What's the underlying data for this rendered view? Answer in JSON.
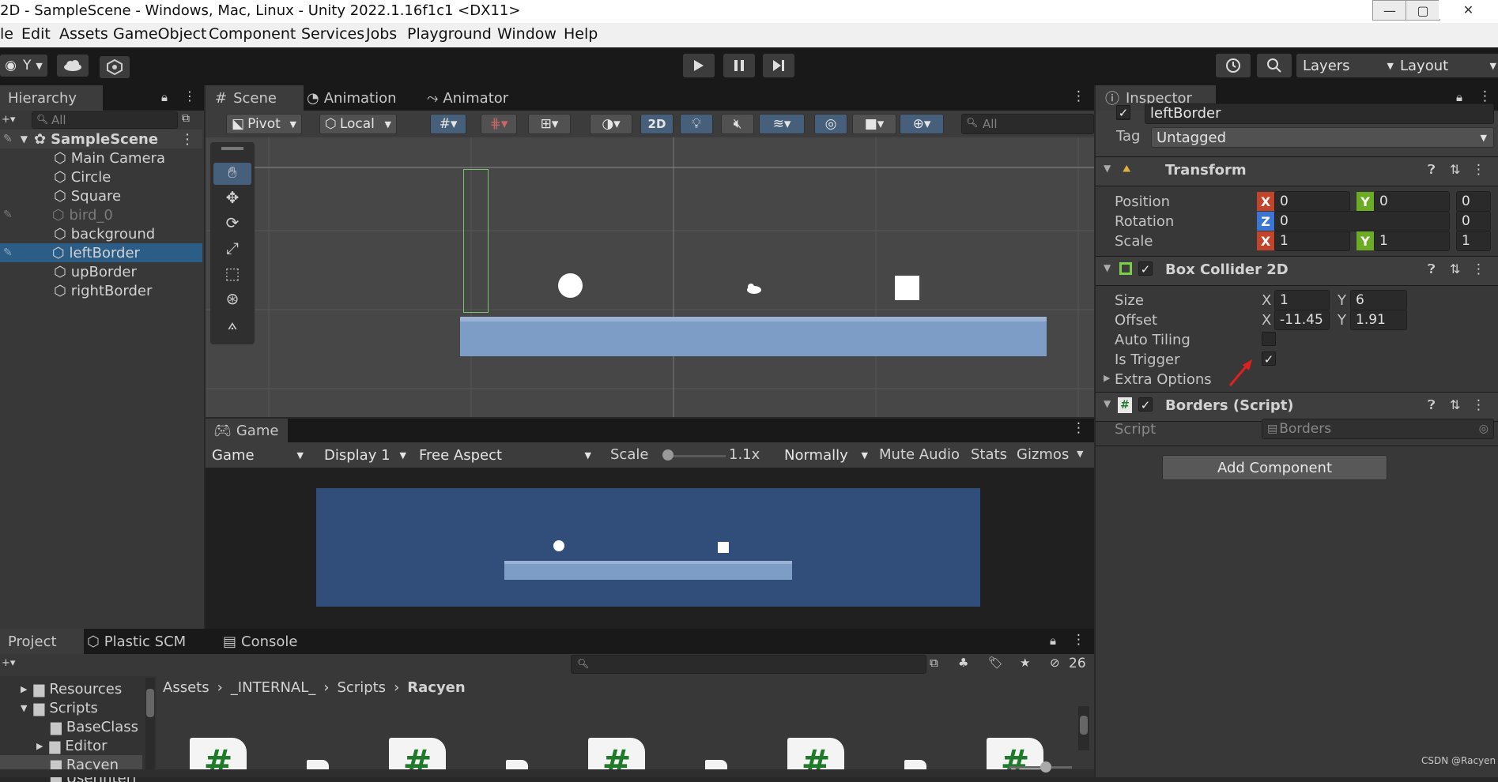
{
  "window": {
    "title": "2D - SampleScene - Windows, Mac, Linux - Unity 2022.1.16f1c1 <DX11>",
    "min": "—",
    "max": "▢",
    "close": "✕"
  },
  "menu": [
    "le",
    "Edit",
    "Assets",
    "GameObject",
    "Component",
    "Services",
    "Jobs",
    "Playground",
    "Window",
    "Help"
  ],
  "toolbar": {
    "account_label": "Y",
    "layers_label": "Layers",
    "layout_label": "Layout"
  },
  "hierarchy": {
    "tab_label": "Hierarchy",
    "search_placeholder": "All",
    "scene_name": "SampleScene",
    "items": [
      {
        "label": "Main Camera"
      },
      {
        "label": "Circle"
      },
      {
        "label": "Square"
      },
      {
        "label": "bird_0"
      },
      {
        "label": "background"
      },
      {
        "label": "leftBorder"
      },
      {
        "label": "upBorder"
      },
      {
        "label": "rightBorder"
      }
    ]
  },
  "scene_tabs": [
    "Scene",
    "Animation",
    "Animator"
  ],
  "scene_toolbar": {
    "pivot": "Pivot",
    "local": "Local",
    "mode_2d": "2D",
    "search_placeholder": "All"
  },
  "game": {
    "tab_label": "Game",
    "mode": "Game",
    "display": "Display 1",
    "aspect": "Free Aspect",
    "scale_label": "Scale",
    "scale_value": "1.1x",
    "play_focus": "Normally",
    "mute": "Mute Audio",
    "stats": "Stats",
    "gizmos": "Gizmos"
  },
  "inspector": {
    "tab_label": "Inspector",
    "object_name": "leftBorder",
    "tag_label": "Tag",
    "tag_value": "Untagged",
    "transform": {
      "title": "Transform",
      "position_label": "Position",
      "rotation_label": "Rotation",
      "scale_label": "Scale",
      "position": {
        "x": "0",
        "y": "0",
        "z": "0"
      },
      "rotation": {
        "z": "0",
        "w": "0"
      },
      "scale": {
        "x": "1",
        "y": "1",
        "z": "1"
      }
    },
    "collider": {
      "title": "Box Collider 2D",
      "size_label": "Size",
      "offset_label": "Offset",
      "auto_tiling_label": "Auto Tiling",
      "is_trigger_label": "Is Trigger",
      "extra_label": "Extra Options",
      "size": {
        "x": "1",
        "y": "6"
      },
      "offset": {
        "x": "-11.45",
        "y": "1.91"
      }
    },
    "script_comp": {
      "title": "Borders (Script)",
      "script_label": "Script",
      "script_value": "Borders"
    },
    "add_component": "Add Component",
    "axis": {
      "x": "X",
      "y": "Y",
      "z": "Z"
    }
  },
  "bottom": {
    "tabs": [
      "Project",
      "Plastic SCM",
      "Console"
    ],
    "hidden_count": "26",
    "tree": [
      {
        "label": "Resources"
      },
      {
        "label": "Scripts"
      },
      {
        "label": "BaseClass"
      },
      {
        "label": "Editor"
      },
      {
        "label": "Racyen"
      },
      {
        "label": "UserInterf"
      }
    ],
    "breadcrumb": [
      "Assets",
      "_INTERNAL_",
      "Scripts",
      "Racyen"
    ]
  },
  "watermark": "CSDN @Racyen",
  "colors": {
    "selection": "#2c5d87",
    "x_axis": "#c2442b",
    "y_axis": "#6cab24",
    "z_axis": "#3b76d3",
    "game_bg": "#314d79",
    "platform": "#7d9cc6"
  }
}
